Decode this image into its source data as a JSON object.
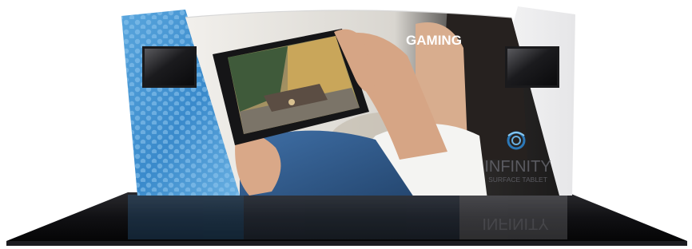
{
  "scene": {
    "center_panel": {
      "label": "GAMING"
    },
    "right_panel": {
      "brand_name": "INFINITY",
      "brand_tagline": "SURFACE TABLET",
      "logo_icon": "swirl-ring-icon"
    },
    "left_panel": {
      "pattern": "hexagon-dots"
    },
    "monitors": [
      "left-monitor",
      "right-monitor"
    ],
    "floor": {
      "reflection_text": "INFINITY"
    }
  },
  "colors": {
    "left_panel_blue": "#3e8fd0",
    "right_panel_gray": "#e9e9ea",
    "floor_black": "#0d0d0f",
    "brand_blue": "#2b78b8",
    "brand_text": "#5a5a60"
  }
}
